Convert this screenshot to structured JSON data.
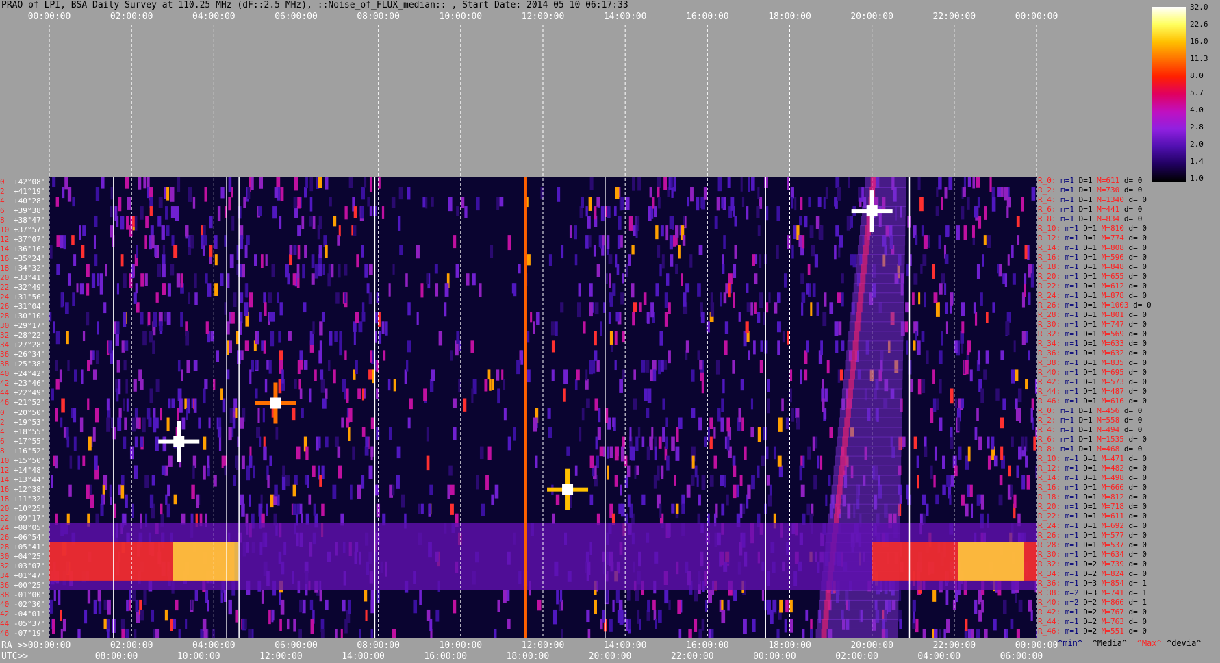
{
  "title": "PRAO of LPI, BSA Daily Survey at 110.25 MHz (dF::2.5 MHz), ::Noise_of_FLUX_median:: , Start Date: 2014 05 10 06:17:33",
  "top_axis_labels": [
    "00:00:00",
    "02:00:00",
    "04:00:00",
    "06:00:00",
    "08:00:00",
    "10:00:00",
    "12:00:00",
    "14:00:00",
    "16:00:00",
    "18:00:00",
    "20:00:00",
    "22:00:00",
    "00:00:00"
  ],
  "bottom_ra_prefix": "RA >>",
  "bottom_ra_labels": [
    "00:00:00",
    "02:00:00",
    "04:00:00",
    "06:00:00",
    "08:00:00",
    "10:00:00",
    "12:00:00",
    "14:00:00",
    "16:00:00",
    "18:00:00",
    "20:00:00",
    "22:00:00",
    "00:00:00"
  ],
  "bottom_utc_prefix": "UTC>>",
  "bottom_utc_labels": [
    "08:00:00",
    "10:00:00",
    "12:00:00",
    "14:00:00",
    "16:00:00",
    "18:00:00",
    "20:00:00",
    "22:00:00",
    "00:00:00",
    "02:00:00",
    "04:00:00",
    "06:00:00"
  ],
  "stat_legend": {
    "min": "^min^",
    "median": "^Media^",
    "max": "^Max^",
    "devia": "^devia^"
  },
  "colorbar": {
    "labels": [
      "32.0",
      "22.6",
      "16.0",
      "11.3",
      "8.0",
      "5.7",
      "4.0",
      "2.8",
      "2.0",
      "1.4",
      "1.0"
    ],
    "colors": [
      "#ffffff",
      "#ffff60",
      "#ffc000",
      "#ff7000",
      "#ff2000",
      "#e00060",
      "#c010c0",
      "#9020e0",
      "#5010b0",
      "#200060",
      "#000000"
    ]
  },
  "dec_rows": [
    {
      "idx": "0",
      "dec": "+42°08'"
    },
    {
      "idx": "2",
      "dec": "+41°19'"
    },
    {
      "idx": "4",
      "dec": "+40°28'"
    },
    {
      "idx": "6",
      "dec": "+39°38'"
    },
    {
      "idx": "8",
      "dec": "+38°47'"
    },
    {
      "idx": "10",
      "dec": "+37°57'"
    },
    {
      "idx": "12",
      "dec": "+37°07'"
    },
    {
      "idx": "14",
      "dec": "+36°16'"
    },
    {
      "idx": "16",
      "dec": "+35°24'"
    },
    {
      "idx": "18",
      "dec": "+34°32'"
    },
    {
      "idx": "20",
      "dec": "+33°41'"
    },
    {
      "idx": "22",
      "dec": "+32°49'"
    },
    {
      "idx": "24",
      "dec": "+31°56'"
    },
    {
      "idx": "26",
      "dec": "+31°04'"
    },
    {
      "idx": "28",
      "dec": "+30°10'"
    },
    {
      "idx": "30",
      "dec": "+29°17'"
    },
    {
      "idx": "32",
      "dec": "+28°22'"
    },
    {
      "idx": "34",
      "dec": "+27°28'"
    },
    {
      "idx": "36",
      "dec": "+26°34'"
    },
    {
      "idx": "38",
      "dec": "+25°38'"
    },
    {
      "idx": "40",
      "dec": "+24°42'"
    },
    {
      "idx": "42",
      "dec": "+23°46'"
    },
    {
      "idx": "44",
      "dec": "+22°49'"
    },
    {
      "idx": "46",
      "dec": "+21°52'"
    },
    {
      "idx": "0",
      "dec": "+20°50'"
    },
    {
      "idx": "2",
      "dec": "+19°53'"
    },
    {
      "idx": "4",
      "dec": "+18°55'"
    },
    {
      "idx": "6",
      "dec": "+17°55'"
    },
    {
      "idx": "8",
      "dec": "+16°52'"
    },
    {
      "idx": "10",
      "dec": "+15°50'"
    },
    {
      "idx": "12",
      "dec": "+14°48'"
    },
    {
      "idx": "14",
      "dec": "+13°44'"
    },
    {
      "idx": "16",
      "dec": "+12°38'"
    },
    {
      "idx": "18",
      "dec": "+11°32'"
    },
    {
      "idx": "20",
      "dec": "+10°25'"
    },
    {
      "idx": "22",
      "dec": "+09°17'"
    },
    {
      "idx": "24",
      "dec": "+08°05'"
    },
    {
      "idx": "26",
      "dec": "+06°54'"
    },
    {
      "idx": "28",
      "dec": "+05°41'"
    },
    {
      "idx": "30",
      "dec": "+04°25'"
    },
    {
      "idx": "32",
      "dec": "+03°07'"
    },
    {
      "idx": "34",
      "dec": "+01°47'"
    },
    {
      "idx": "36",
      "dec": "+00°25'"
    },
    {
      "idx": "38",
      "dec": "-01°00'"
    },
    {
      "idx": "40",
      "dec": "-02°30'"
    },
    {
      "idx": "42",
      "dec": "-04°01'"
    },
    {
      "idx": "44",
      "dec": "-05°37'"
    },
    {
      "idx": "46",
      "dec": "-07°19'"
    }
  ],
  "stats_rows": [
    {
      "r": "R_0:",
      "m": "m=1",
      "d": "D=1",
      "M": "M=611",
      "dv": "d= 0"
    },
    {
      "r": "R_2:",
      "m": "m=1",
      "d": "D=1",
      "M": "M=730",
      "dv": "d= 0"
    },
    {
      "r": "R_4:",
      "m": "m=1",
      "d": "D=1",
      "M": "M=1340",
      "dv": "d= 0"
    },
    {
      "r": "R_6:",
      "m": "m=1",
      "d": "D=1",
      "M": "M=441",
      "dv": "d= 0"
    },
    {
      "r": "R_8:",
      "m": "m=1",
      "d": "D=1",
      "M": "M=834",
      "dv": "d= 0"
    },
    {
      "r": "R_10:",
      "m": "m=1",
      "d": "D=1",
      "M": "M=810",
      "dv": "d= 0"
    },
    {
      "r": "R_12:",
      "m": "m=1",
      "d": "D=1",
      "M": "M=774",
      "dv": "d= 0"
    },
    {
      "r": "R_14:",
      "m": "m=1",
      "d": "D=1",
      "M": "M=808",
      "dv": "d= 0"
    },
    {
      "r": "R_16:",
      "m": "m=1",
      "d": "D=1",
      "M": "M=596",
      "dv": "d= 0"
    },
    {
      "r": "R_18:",
      "m": "m=1",
      "d": "D=1",
      "M": "M=848",
      "dv": "d= 0"
    },
    {
      "r": "R_20:",
      "m": "m=1",
      "d": "D=1",
      "M": "M=655",
      "dv": "d= 0"
    },
    {
      "r": "R_22:",
      "m": "m=1",
      "d": "D=1",
      "M": "M=612",
      "dv": "d= 0"
    },
    {
      "r": "R_24:",
      "m": "m=1",
      "d": "D=1",
      "M": "M=878",
      "dv": "d= 0"
    },
    {
      "r": "R_26:",
      "m": "m=1",
      "d": "D=1",
      "M": "M=1003",
      "dv": "d= 0"
    },
    {
      "r": "R_28:",
      "m": "m=1",
      "d": "D=1",
      "M": "M=801",
      "dv": "d= 0"
    },
    {
      "r": "R_30:",
      "m": "m=1",
      "d": "D=1",
      "M": "M=747",
      "dv": "d= 0"
    },
    {
      "r": "R_32:",
      "m": "m=1",
      "d": "D=1",
      "M": "M=569",
      "dv": "d= 0"
    },
    {
      "r": "R_34:",
      "m": "m=1",
      "d": "D=1",
      "M": "M=633",
      "dv": "d= 0"
    },
    {
      "r": "R_36:",
      "m": "m=1",
      "d": "D=1",
      "M": "M=632",
      "dv": "d= 0"
    },
    {
      "r": "R_38:",
      "m": "m=1",
      "d": "D=1",
      "M": "M=835",
      "dv": "d= 0"
    },
    {
      "r": "R_40:",
      "m": "m=1",
      "d": "D=1",
      "M": "M=695",
      "dv": "d= 0"
    },
    {
      "r": "R_42:",
      "m": "m=1",
      "d": "D=1",
      "M": "M=573",
      "dv": "d= 0"
    },
    {
      "r": "R_44:",
      "m": "m=1",
      "d": "D=1",
      "M": "M=487",
      "dv": "d= 0"
    },
    {
      "r": "R_46:",
      "m": "m=1",
      "d": "D=1",
      "M": "M=616",
      "dv": "d= 0"
    },
    {
      "r": "R_0:",
      "m": "m=1",
      "d": "D=1",
      "M": "M=456",
      "dv": "d= 0"
    },
    {
      "r": "R_2:",
      "m": "m=1",
      "d": "D=1",
      "M": "M=558",
      "dv": "d= 0"
    },
    {
      "r": "R_4:",
      "m": "m=1",
      "d": "D=1",
      "M": "M=494",
      "dv": "d= 0"
    },
    {
      "r": "R_6:",
      "m": "m=1",
      "d": "D=1",
      "M": "M=1535",
      "dv": "d= 0"
    },
    {
      "r": "R_8:",
      "m": "m=1",
      "d": "D=1",
      "M": "M=468",
      "dv": "d= 0"
    },
    {
      "r": "R_10:",
      "m": "m=1",
      "d": "D=1",
      "M": "M=471",
      "dv": "d= 0"
    },
    {
      "r": "R_12:",
      "m": "m=1",
      "d": "D=1",
      "M": "M=482",
      "dv": "d= 0"
    },
    {
      "r": "R_14:",
      "m": "m=1",
      "d": "D=1",
      "M": "M=498",
      "dv": "d= 0"
    },
    {
      "r": "R_16:",
      "m": "m=1",
      "d": "D=1",
      "M": "M=666",
      "dv": "d= 0"
    },
    {
      "r": "R_18:",
      "m": "m=1",
      "d": "D=1",
      "M": "M=812",
      "dv": "d= 0"
    },
    {
      "r": "R_20:",
      "m": "m=1",
      "d": "D=1",
      "M": "M=718",
      "dv": "d= 0"
    },
    {
      "r": "R_22:",
      "m": "m=1",
      "d": "D=1",
      "M": "M=611",
      "dv": "d= 0"
    },
    {
      "r": "R_24:",
      "m": "m=1",
      "d": "D=1",
      "M": "M=692",
      "dv": "d= 0"
    },
    {
      "r": "R_26:",
      "m": "m=1",
      "d": "D=1",
      "M": "M=577",
      "dv": "d= 0"
    },
    {
      "r": "R_28:",
      "m": "m=1",
      "d": "D=1",
      "M": "M=537",
      "dv": "d= 0"
    },
    {
      "r": "R_30:",
      "m": "m=1",
      "d": "D=1",
      "M": "M=634",
      "dv": "d= 0"
    },
    {
      "r": "R_32:",
      "m": "m=1",
      "d": "D=2",
      "M": "M=739",
      "dv": "d= 0"
    },
    {
      "r": "R_34:",
      "m": "m=1",
      "d": "D=2",
      "M": "M=824",
      "dv": "d= 0"
    },
    {
      "r": "R_36:",
      "m": "m=1",
      "d": "D=3",
      "M": "M=854",
      "dv": "d= 1"
    },
    {
      "r": "R_38:",
      "m": "m=2",
      "d": "D=3",
      "M": "M=741",
      "dv": "d= 1"
    },
    {
      "r": "R_40:",
      "m": "m=2",
      "d": "D=2",
      "M": "M=866",
      "dv": "d= 1"
    },
    {
      "r": "R_42:",
      "m": "m=1",
      "d": "D=2",
      "M": "M=767",
      "dv": "d= 0"
    },
    {
      "r": "R_44:",
      "m": "m=1",
      "d": "D=2",
      "M": "M=763",
      "dv": "d= 0"
    },
    {
      "r": "R_46:",
      "m": "m=1",
      "d": "D=2",
      "M": "M=551",
      "dv": "d= 0"
    }
  ],
  "chart_data": {
    "type": "heatmap",
    "title": "PRAO of LPI, BSA Daily Survey at 110.25 MHz (dF::2.5 MHz), ::Noise_of_FLUX_median:: , Start Date: 2014 05 10 06:17:33",
    "x_axis": "RA / UTC (hours)",
    "x_range_hours": [
      0,
      24
    ],
    "rows": 48,
    "colorbar_range": [
      1.0,
      32.0
    ],
    "colorbar_scale": "log2",
    "features": [
      {
        "name": "bright source near RA 03:10, Dec +17°55'",
        "ra_h": 3.15,
        "row": 27,
        "level": 32.0
      },
      {
        "name": "bright source near RA 20:00, Dec +39°38'",
        "ra_h": 20.0,
        "row": 3,
        "level": 32.0
      },
      {
        "name": "compact source near RA 12:40, Dec +12°38'",
        "ra_h": 12.6,
        "row": 32,
        "level": 16.0
      },
      {
        "name": "compact source near RA 05:50, Dec +21°52'",
        "ra_h": 5.5,
        "row": 23,
        "level": 11.3
      },
      {
        "name": "interference column near RA 11:30",
        "ra_h": 11.55,
        "level": 8.0
      },
      {
        "name": "galactic plane ridge",
        "ra_start_h": 20.0,
        "ra_end_h": 18.8,
        "level": 5.7
      },
      {
        "name": "bright low-declination band",
        "rows": [
          36,
          43
        ],
        "level": 16.0
      }
    ]
  }
}
